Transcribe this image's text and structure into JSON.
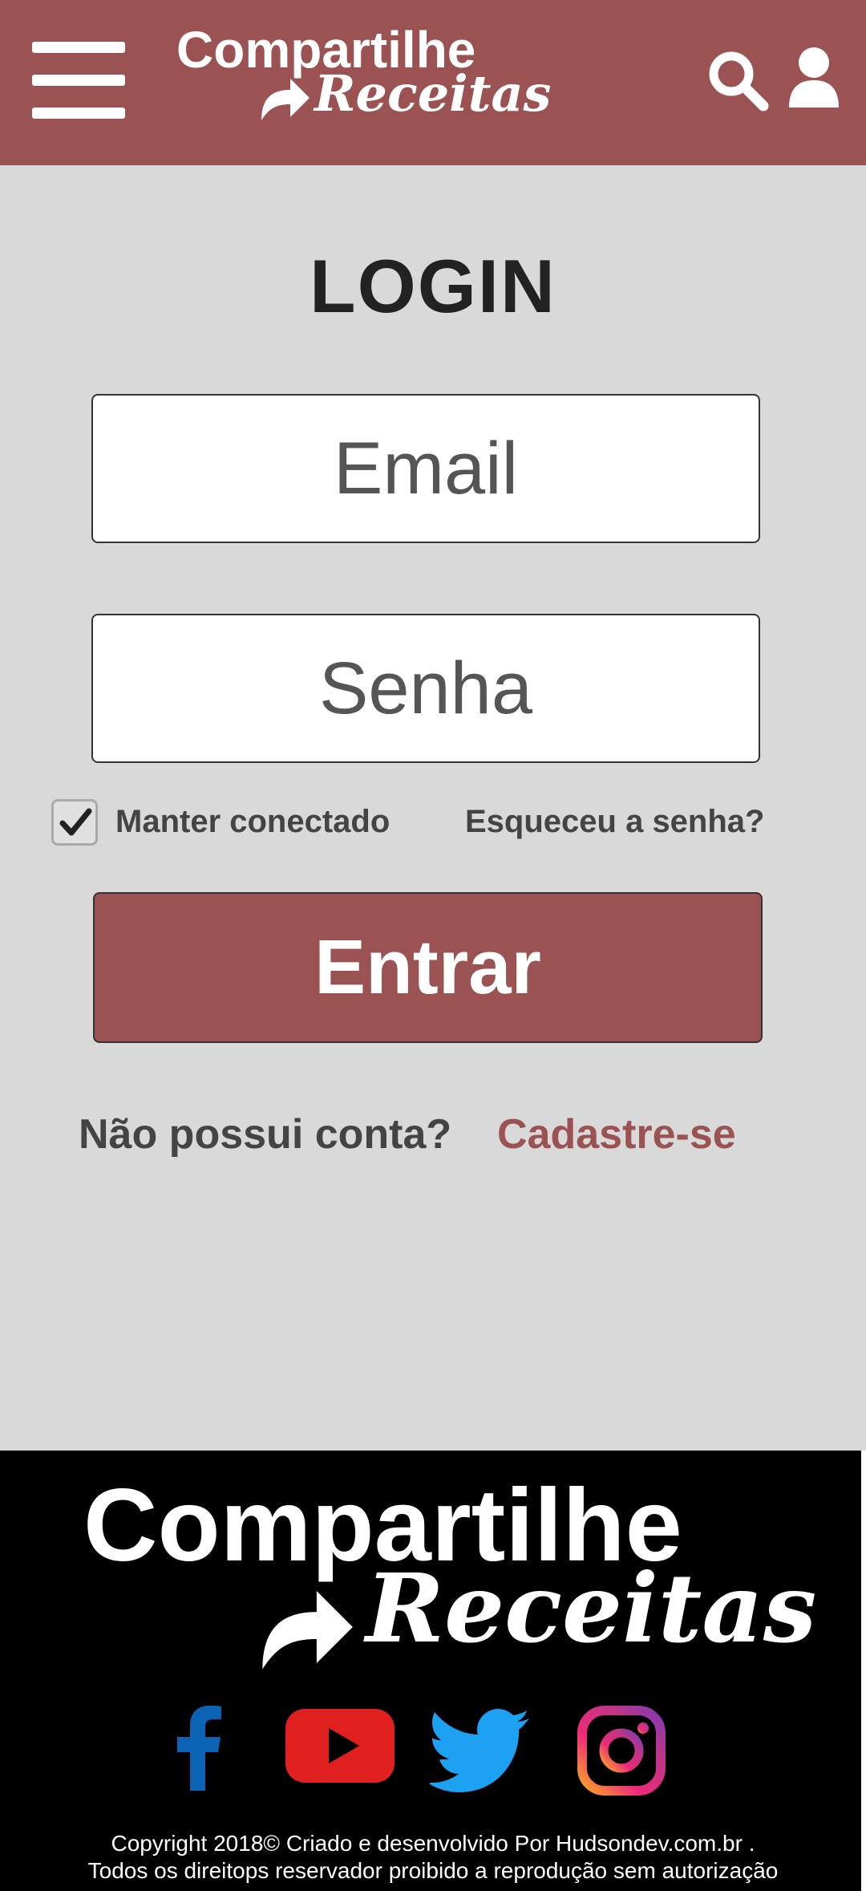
{
  "header": {
    "logo_line1": "Compartilhe",
    "logo_line2": "Receitas"
  },
  "login": {
    "title": "LOGIN",
    "email_placeholder": "Email",
    "password_placeholder": "Senha",
    "remember_label": "Manter conectado",
    "remember_checked": true,
    "forgot_label": "Esqueceu a senha?",
    "submit_label": "Entrar",
    "no_account_text": "Não possui conta?",
    "signup_label": "Cadastre-se"
  },
  "footer": {
    "logo_line1": "Compartilhe",
    "logo_line2": "Receitas",
    "social": [
      "facebook-icon",
      "youtube-icon",
      "twitter-icon",
      "instagram-icon"
    ],
    "copyright_line1": "Copyright 2018© Criado e desenvolvido Por Hudsondev.com.br  .",
    "copyright_line2": "Todos os direitops reservador proibido a reprodução sem autorização"
  },
  "colors": {
    "brand": "#9a5252",
    "background": "#d9d9d9",
    "footer": "#000000",
    "facebook": "#0b63b5",
    "youtube": "#e01f1f",
    "twitter": "#1da1f2"
  }
}
